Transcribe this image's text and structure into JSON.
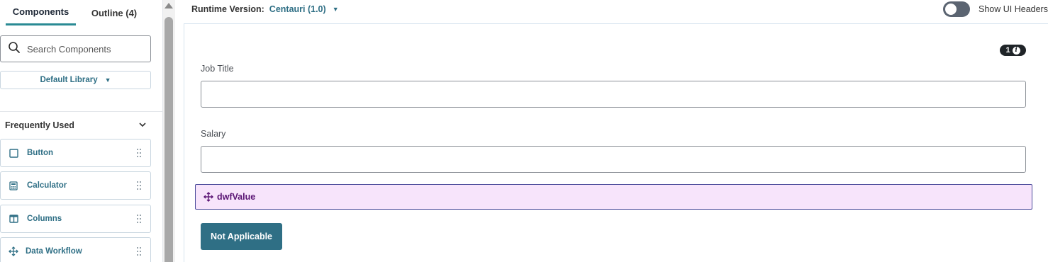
{
  "tabs": [
    {
      "label": "Components"
    },
    {
      "label": "Outline (4)"
    }
  ],
  "search": {
    "placeholder": "Search Components",
    "icon": "search-icon"
  },
  "library": {
    "selected": "Default Library"
  },
  "section": {
    "title": "Frequently Used"
  },
  "components": [
    {
      "label": "Button",
      "icon": "button-square-icon"
    },
    {
      "label": "Calculator",
      "icon": "calculator-icon"
    },
    {
      "label": "Columns",
      "icon": "columns-icon"
    },
    {
      "label": "Data Workflow",
      "icon": "move-arrows-icon"
    }
  ],
  "topbar": {
    "runtime_label": "Runtime Version:",
    "runtime_value": "Centauri (1.0)",
    "ui_headers_label": "Show UI Headers",
    "ui_headers_on": false
  },
  "canvas": {
    "badge_count": "1",
    "fields": [
      {
        "label": "Job Title",
        "value": ""
      },
      {
        "label": "Salary",
        "value": ""
      }
    ],
    "dwf_label": "dwfValue",
    "button_label": "Not Applicable"
  },
  "colors": {
    "accent": "#2f6f85",
    "tab_underline": "#2a8a94",
    "dwf_background": "#f7e4fb",
    "dwf_text": "#5a1474",
    "toggle_off": "#5b6471"
  }
}
